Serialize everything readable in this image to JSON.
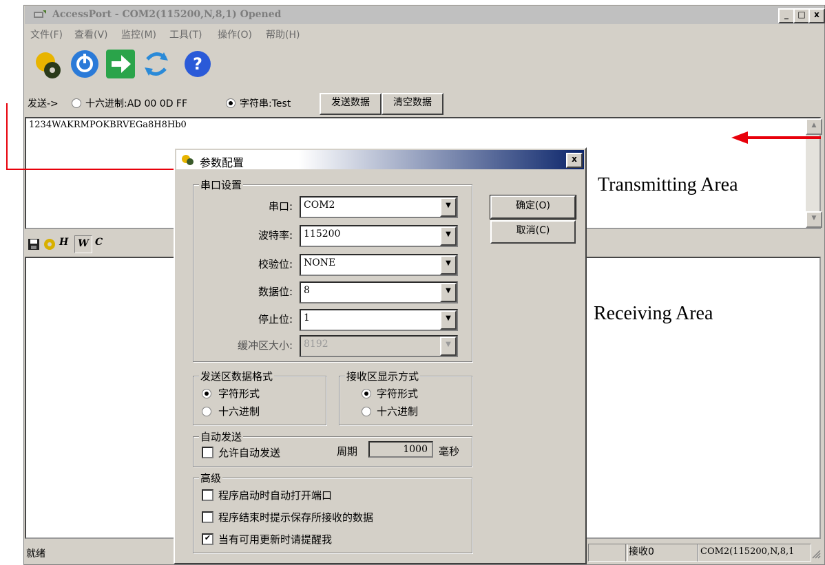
{
  "window": {
    "title": "AccessPort - COM2(115200,N,8,1) Opened",
    "controls": {
      "minimize": "_",
      "maximize": "□",
      "close": "x"
    }
  },
  "menu": [
    "文件(F)",
    "查看(V)",
    "监控(M)",
    "工具(T)",
    "操作(O)",
    "帮助(H)"
  ],
  "toolbar": {
    "icons": [
      "settings-gear-icon",
      "power-icon",
      "go-arrow-icon",
      "refresh-arrows-icon",
      "help-icon"
    ]
  },
  "send_bar": {
    "label": "发送->",
    "hex_option": "十六进制:AD 00 0D FF",
    "string_option": "字符串:Test",
    "send_button": "发送数据",
    "clear_button": "清空数据"
  },
  "transmit": {
    "content": "1234WAKRMPOKBRVEGa8H8Hb0"
  },
  "receive_toolbar": {
    "icons": [
      "save-icon",
      "gear-icon",
      "H",
      "W",
      "C"
    ]
  },
  "status": {
    "ready": "就绪",
    "receive": "接收0",
    "port": "COM2(115200,N,8,1"
  },
  "dialog": {
    "title": "参数配置",
    "close": "x",
    "serial_group": "串口设置",
    "fields": [
      {
        "label": "串口:",
        "value": "COM2"
      },
      {
        "label": "波特率:",
        "value": "115200"
      },
      {
        "label": "校验位:",
        "value": "NONE"
      },
      {
        "label": "数据位:",
        "value": "8"
      },
      {
        "label": "停止位:",
        "value": "1"
      },
      {
        "label": "缓冲区大小:",
        "value": "8192"
      }
    ],
    "ok_button": "确定(O)",
    "cancel_button": "取消(C)",
    "send_format": {
      "title": "发送区数据格式",
      "options": [
        "字符形式",
        "十六进制"
      ],
      "selected": "字符形式"
    },
    "recv_format": {
      "title": "接收区显示方式",
      "options": [
        "字符形式",
        "十六进制"
      ],
      "selected": "字符形式"
    },
    "auto_send": {
      "title": "自动发送",
      "allow": "允许自动发送",
      "period_label": "周期",
      "period_value": "1000",
      "unit": "毫秒"
    },
    "advanced": {
      "title": "高级",
      "options": [
        {
          "label": "程序启动时自动打开端口",
          "checked": false
        },
        {
          "label": "程序结束时提示保存所接收的数据",
          "checked": false
        },
        {
          "label": "当有可用更新时请提醒我",
          "checked": true
        }
      ]
    }
  },
  "annotations": {
    "transmitting": "Transmitting Area",
    "receiving": "Receiving Area"
  },
  "colors": {
    "arrow": "#e8000b",
    "dialog_title_dark": "#0a246a",
    "face": "#d4d0c8"
  }
}
